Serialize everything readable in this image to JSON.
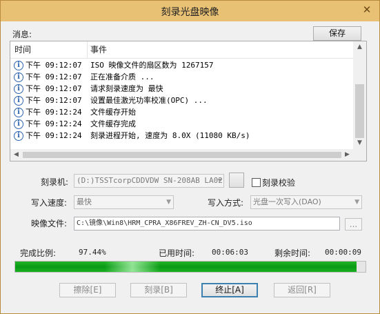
{
  "window": {
    "title": "刻录光盘映像",
    "close_glyph": "✕"
  },
  "messages": {
    "label": "消息:",
    "save_button": "保存"
  },
  "log": {
    "col_time": "时间",
    "col_event": "事件",
    "rows": [
      {
        "time": "下午 09:12:07",
        "event": "ISO 映像文件的扇区数为 1267157"
      },
      {
        "time": "下午 09:12:07",
        "event": "正在准备介质 ..."
      },
      {
        "time": "下午 09:12:07",
        "event": "请求刻录速度为 最快"
      },
      {
        "time": "下午 09:12:07",
        "event": "设置最佳激光功率校准(OPC) ..."
      },
      {
        "time": "下午 09:12:24",
        "event": "文件缓存开始"
      },
      {
        "time": "下午 09:12:24",
        "event": "文件缓存完成"
      },
      {
        "time": "下午 09:12:24",
        "event": "刻录进程开始, 速度为 8.0X (11080 KB/s)"
      }
    ]
  },
  "burner": {
    "label": "刻录机:",
    "value": "(D:)TSSTcorpCDDVDW SN-208AB LA02",
    "verify_label": "刻录校验"
  },
  "speed": {
    "label": "写入速度:",
    "value": "最快"
  },
  "write_mode": {
    "label": "写入方式:",
    "value": "光盘一次写入(DAO)"
  },
  "image_file": {
    "label": "映像文件:",
    "value": "C:\\镜像\\Win8\\HRM_CPRA_X86FREV_ZH-CN_DV5.iso",
    "browse": "..."
  },
  "status": {
    "complete_label": "完成比例:",
    "complete_value": "97.44%",
    "elapsed_label": "已用时间:",
    "elapsed_value": "00:06:03",
    "remaining_label": "剩余时间:",
    "remaining_value": "00:00:09"
  },
  "progress": {
    "fraction": 0.9744,
    "color": "#10a81c"
  },
  "buttons": {
    "erase": "擦除[E]",
    "burn": "刻录[B]",
    "stop": "终止[A]",
    "back": "返回[R]"
  }
}
